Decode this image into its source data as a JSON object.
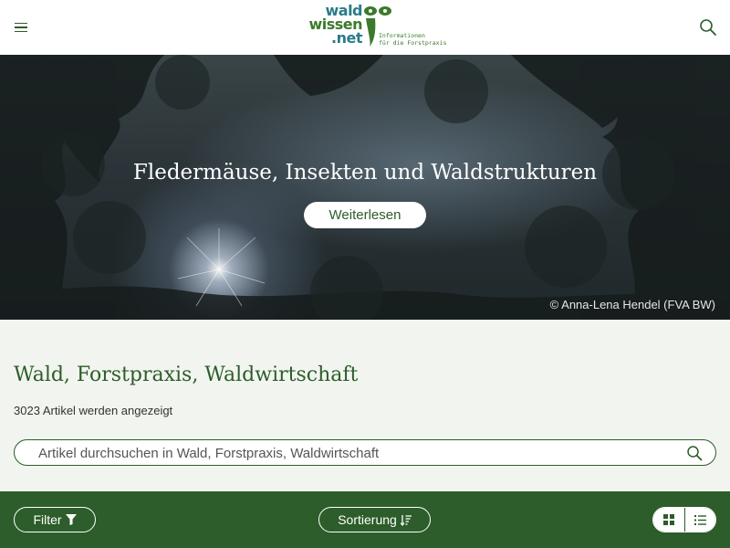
{
  "logo": {
    "line1": "wald",
    "line2": "wissen",
    "line3": ".net",
    "tagline1": "Informationen",
    "tagline2": "für die Forstpraxis"
  },
  "header": {
    "menu_icon": "hamburger-menu-icon",
    "search_icon": "search-icon"
  },
  "hero": {
    "title": "Fledermäuse, Insekten und Waldstrukturen",
    "button_label": "Weiterlesen",
    "credit": "© Anna-Lena Hendel (FVA BW)"
  },
  "section": {
    "title": "Wald, Forstpraxis, Waldwirtschaft",
    "count_text": "3023 Artikel werden angezeigt",
    "search_placeholder": "Artikel durchsuchen in Wald, Forstpraxis, Waldwirtschaft"
  },
  "bottom_bar": {
    "filter_label": "Filter",
    "filter_icon": "funnel-icon",
    "sort_label": "Sortierung",
    "sort_icon": "sort-descending-icon",
    "grid_view_icon": "grid-view-icon",
    "list_view_icon": "list-view-icon"
  },
  "colors": {
    "brand_green": "#2d5d2a",
    "logo_teal": "#2a7b8a",
    "background": "#f2f5ef"
  }
}
